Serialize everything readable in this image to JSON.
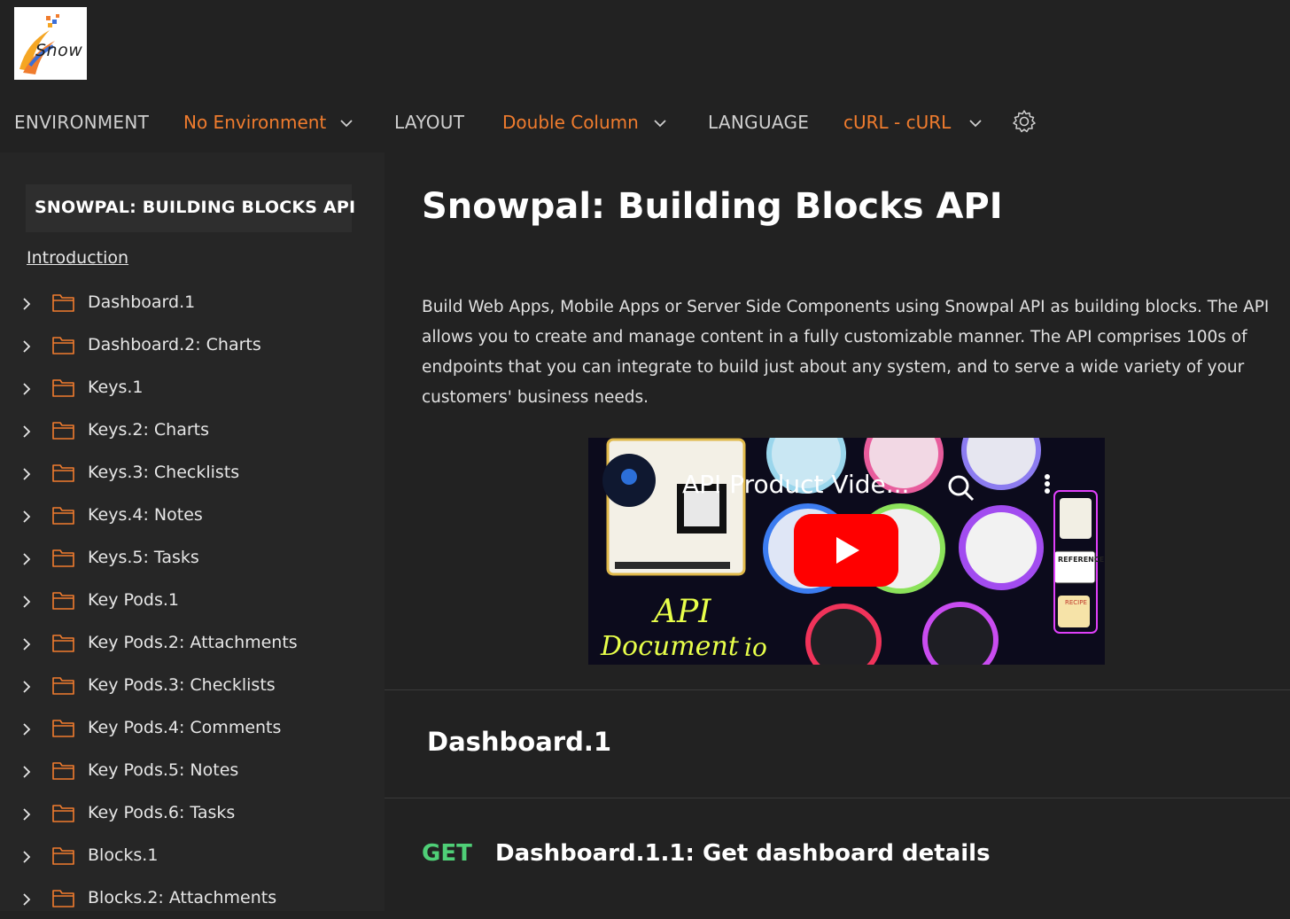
{
  "logo": {
    "text": "Snow"
  },
  "nav": {
    "environment_label": "ENVIRONMENT",
    "environment_value": "No Environment",
    "layout_label": "LAYOUT",
    "layout_value": "Double Column",
    "language_label": "LANGUAGE",
    "language_value": "cURL - cURL"
  },
  "sidebar": {
    "title": "SNOWPAL: BUILDING BLOCKS API",
    "intro": "Introduction",
    "items": [
      {
        "label": "Dashboard.1"
      },
      {
        "label": "Dashboard.2: Charts"
      },
      {
        "label": "Keys.1"
      },
      {
        "label": "Keys.2: Charts"
      },
      {
        "label": "Keys.3: Checklists"
      },
      {
        "label": "Keys.4: Notes"
      },
      {
        "label": "Keys.5: Tasks"
      },
      {
        "label": "Key Pods.1"
      },
      {
        "label": "Key Pods.2: Attachments"
      },
      {
        "label": "Key Pods.3: Checklists"
      },
      {
        "label": "Key Pods.4: Comments"
      },
      {
        "label": "Key Pods.5: Notes"
      },
      {
        "label": "Key Pods.6: Tasks"
      },
      {
        "label": "Blocks.1"
      },
      {
        "label": "Blocks.2: Attachments"
      }
    ]
  },
  "main": {
    "title": "Snowpal: Building Blocks API",
    "description": "Build Web Apps, Mobile Apps or Server Side Components using Snowpal API as building blocks. The API allows you to create and manage content in a fully customizable manner. The API comprises 100s of endpoints that you can integrate to build just about any system, and to serve a wide variety of your customers' business needs.",
    "video": {
      "title": "API Product Vide...",
      "neon_text_1": "API",
      "neon_text_2": "Document",
      "neon_text_3": "io",
      "badge_reference": "REFERENCE",
      "badge_recipe": "RECIPE"
    },
    "section_title": "Dashboard.1",
    "endpoint": {
      "method": "GET",
      "name": "Dashboard.1.1: Get dashboard details"
    }
  },
  "colors": {
    "accent": "#f07c2e",
    "get_method": "#4fcf77",
    "background": "#222222",
    "sidebar": "#262626"
  }
}
